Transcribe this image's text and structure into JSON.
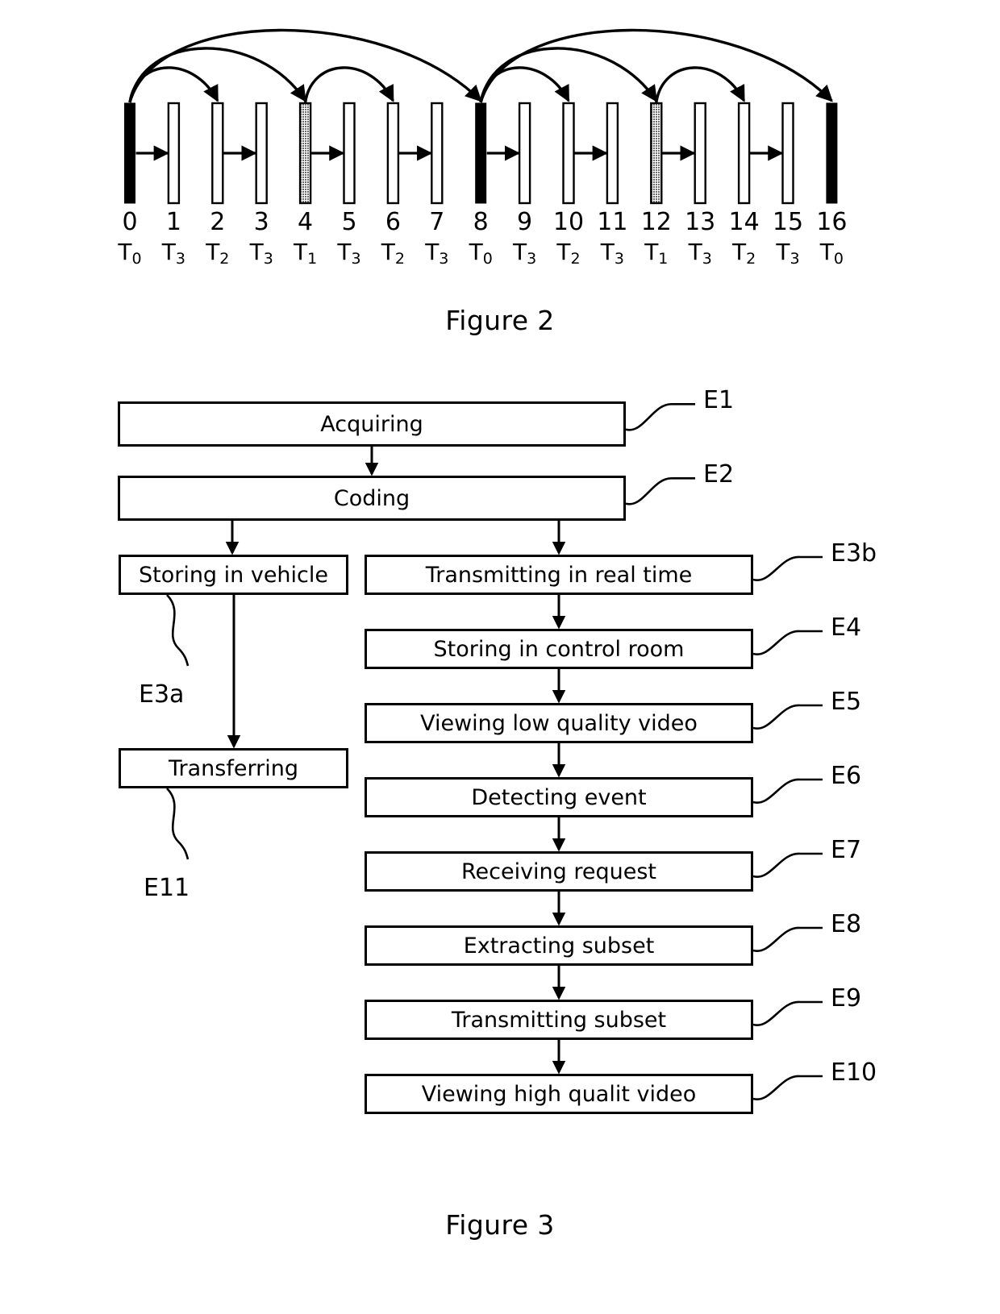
{
  "figure2": {
    "caption": "Figure 2",
    "chart_data": {
      "type": "diagram",
      "title": "Figure 2",
      "description": "Hierarchical B-frame GOP prediction structure over 17 frames",
      "xlabel": "",
      "ylabel": "",
      "frame_indices": [
        "0",
        "1",
        "2",
        "3",
        "4",
        "5",
        "6",
        "7",
        "8",
        "9",
        "10",
        "11",
        "12",
        "13",
        "14",
        "15",
        "16"
      ],
      "temporal_layers": [
        "T0",
        "T3",
        "T2",
        "T3",
        "T1",
        "T3",
        "T2",
        "T3",
        "T0",
        "T3",
        "T2",
        "T3",
        "T1",
        "T3",
        "T2",
        "T3",
        "T0"
      ],
      "tier_subscripts": [
        "0",
        "3",
        "2",
        "3",
        "1",
        "3",
        "2",
        "3",
        "0",
        "3",
        "2",
        "3",
        "1",
        "3",
        "2",
        "3",
        "0"
      ],
      "tier_base": "T",
      "bar_fills": [
        "black",
        "white",
        "white",
        "white",
        "gray",
        "white",
        "white",
        "white",
        "black",
        "white",
        "white",
        "white",
        "gray",
        "white",
        "white",
        "white",
        "black"
      ],
      "fill_colors": {
        "black": "#000000",
        "gray": "#8c8c8c",
        "white": "#ffffff"
      },
      "forward_arrows": [
        {
          "from": 0,
          "to": 1
        },
        {
          "from": 2,
          "to": 3
        },
        {
          "from": 4,
          "to": 5
        },
        {
          "from": 6,
          "to": 7
        },
        {
          "from": 8,
          "to": 9
        },
        {
          "from": 10,
          "to": 11
        },
        {
          "from": 12,
          "to": 13
        },
        {
          "from": 14,
          "to": 15
        }
      ],
      "arcs": [
        {
          "from": 0,
          "to": 8,
          "level": 3
        },
        {
          "from": 0,
          "to": 4,
          "level": 2
        },
        {
          "from": 0,
          "to": 2,
          "level": 1
        },
        {
          "from": 4,
          "to": 6,
          "level": 1
        },
        {
          "from": 8,
          "to": 16,
          "level": 3
        },
        {
          "from": 8,
          "to": 12,
          "level": 2
        },
        {
          "from": 8,
          "to": 10,
          "level": 1
        },
        {
          "from": 12,
          "to": 14,
          "level": 1
        }
      ]
    }
  },
  "figure3": {
    "caption": "Figure 3",
    "boxes": [
      {
        "id": "E1",
        "label": "Acquiring",
        "ref": "E1",
        "column": "full"
      },
      {
        "id": "E2",
        "label": "Coding",
        "ref": "E2",
        "column": "full"
      },
      {
        "id": "E3a",
        "label": "Storing in vehicle",
        "ref": "E3a",
        "column": "left"
      },
      {
        "id": "E11",
        "label": "Transferring",
        "ref": "E11",
        "column": "left"
      },
      {
        "id": "E3b",
        "label": "Transmitting in real time",
        "ref": "E3b",
        "column": "right"
      },
      {
        "id": "E4",
        "label": "Storing in control room",
        "ref": "E4",
        "column": "right"
      },
      {
        "id": "E5",
        "label": "Viewing low quality video",
        "ref": "E5",
        "column": "right"
      },
      {
        "id": "E6",
        "label": "Detecting event",
        "ref": "E6",
        "column": "right"
      },
      {
        "id": "E7",
        "label": "Receiving request",
        "ref": "E7",
        "column": "right"
      },
      {
        "id": "E8",
        "label": "Extracting subset",
        "ref": "E8",
        "column": "right"
      },
      {
        "id": "E9",
        "label": "Transmitting subset",
        "ref": "E9",
        "column": "right"
      },
      {
        "id": "E10",
        "label": "Viewing high qualit video",
        "ref": "E10",
        "column": "right"
      }
    ]
  }
}
